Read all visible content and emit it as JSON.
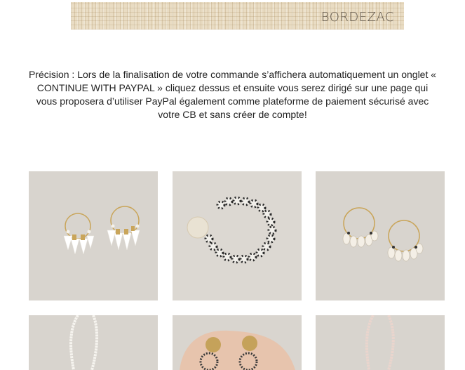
{
  "header": {
    "brand": "BORDEZAC"
  },
  "notice": {
    "text": "Précision : Lors de la finalisation de votre commande s’affichera automatiquement un onglet « CONTINUE WITH PAYPAL » cliquez dessus et ensuite vous serez dirigé sur une page qui vous proposera d’utiliser PayPal également comme plateforme de paiement sécurisé avec votre CB et sans créer de compte!"
  },
  "products": [
    {
      "image": "tassel-hoop-earrings"
    },
    {
      "image": "speckled-bead-bracelet"
    },
    {
      "image": "cowrie-shell-hoop-earrings"
    },
    {
      "image": "white-bead-necklace"
    },
    {
      "image": "hand-holding-medallion-earrings"
    },
    {
      "image": "pink-bead-necklace"
    }
  ],
  "colors": {
    "banner": "#e9dcc3",
    "tile_background": "#d9d5cf",
    "text": "#222222"
  }
}
